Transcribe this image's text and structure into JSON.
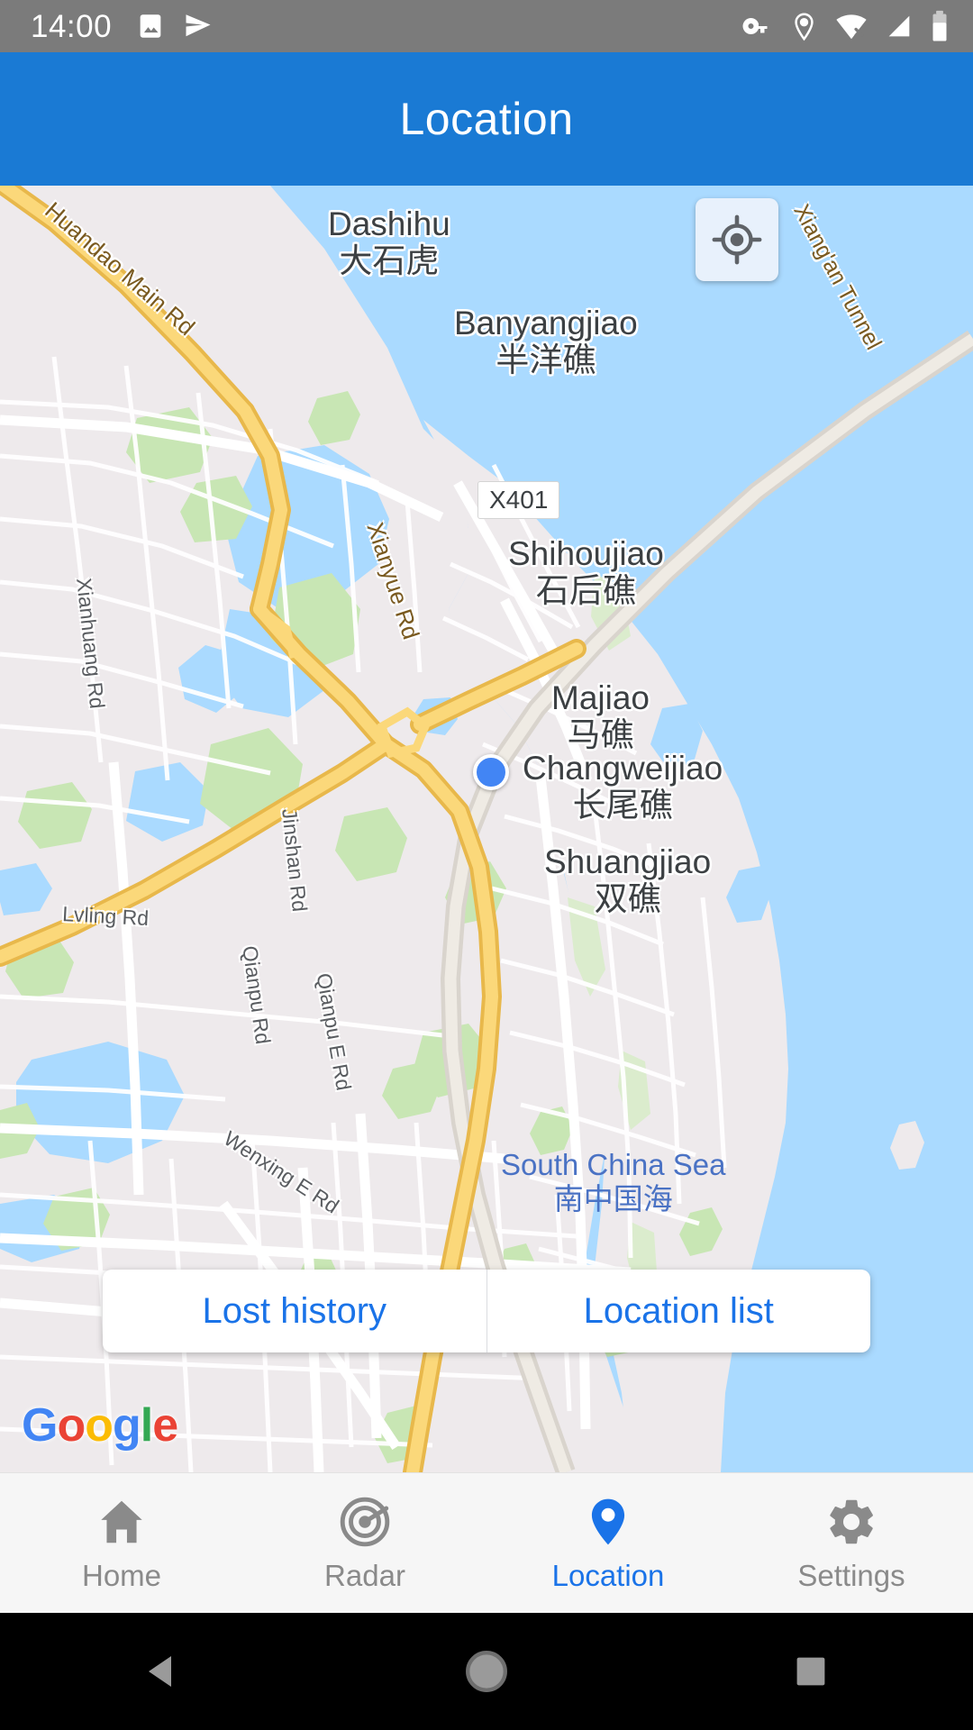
{
  "status_bar": {
    "clock": "14:00",
    "left_icons": [
      "image-icon",
      "send-icon"
    ],
    "right_icons": [
      "vpn-key-icon",
      "location-pin-icon",
      "wifi-off-icon",
      "cellular-signal-icon",
      "battery-icon"
    ]
  },
  "app_bar": {
    "title": "Location"
  },
  "map": {
    "locate_button_icon": "my-location-crosshair-icon",
    "attribution": "Google",
    "attribution_letters": [
      "G",
      "o",
      "o",
      "g",
      "l",
      "e"
    ],
    "my_location_marker": "user-position-dot",
    "pois": [
      {
        "en": "Dashihu",
        "zh": "大石虎"
      },
      {
        "en": "Banyangjiao",
        "zh": "半洋礁"
      },
      {
        "en": "Shihoujiao",
        "zh": "石后礁"
      },
      {
        "en": "Majiao",
        "zh": "马礁"
      },
      {
        "en": "Changweijiao",
        "zh": "长尾礁"
      },
      {
        "en": "Shuangjiao",
        "zh": "双礁"
      }
    ],
    "sea_label": {
      "en": "South China Sea",
      "zh": "南中国海"
    },
    "roads": [
      "Huandao Main Rd",
      "Xiang'an Tunnel",
      "Xianyue Rd",
      "Xianhuang Rd",
      "Jinshan Rd",
      "Lvling Rd",
      "Qianpu Rd",
      "Qianpu E Rd",
      "Wenxing E Rd"
    ],
    "route_shield": "X401"
  },
  "action_bar": {
    "lost_history_label": "Lost history",
    "location_list_label": "Location list"
  },
  "tab_bar": {
    "tabs": [
      {
        "label": "Home",
        "icon": "home-icon",
        "active": false
      },
      {
        "label": "Radar",
        "icon": "radar-icon",
        "active": false
      },
      {
        "label": "Location",
        "icon": "location-pin-icon",
        "active": true
      },
      {
        "label": "Settings",
        "icon": "gear-icon",
        "active": false
      }
    ]
  },
  "nav_bar": {
    "buttons": [
      {
        "name": "back-button",
        "icon": "triangle-left-icon"
      },
      {
        "name": "home-button",
        "icon": "circle-icon"
      },
      {
        "name": "recents-button",
        "icon": "square-icon"
      }
    ]
  },
  "colors": {
    "accent": "#1a73e8",
    "app_bar": "#1a7ad4",
    "status_bar": "#7b7b7b",
    "water": "#aadaff",
    "land": "#eeeaec",
    "highway": "#f9d97a",
    "park": "#c8e6b4"
  }
}
